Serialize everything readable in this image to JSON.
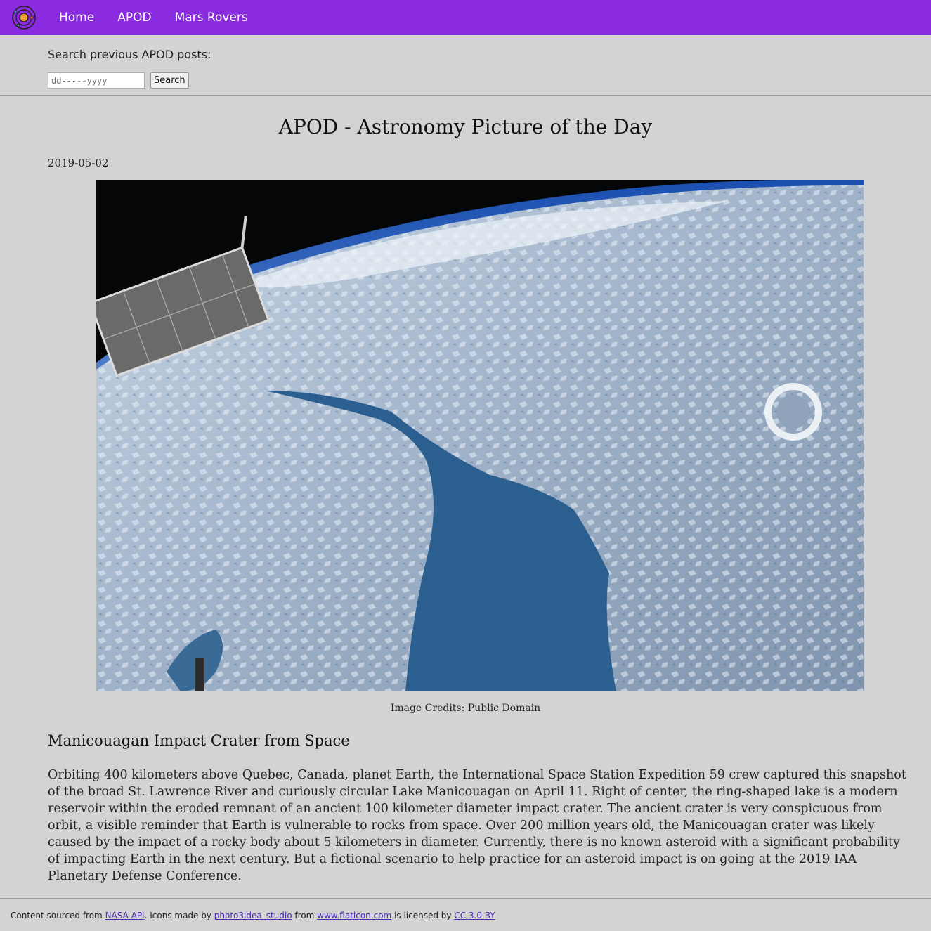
{
  "nav": {
    "logo_icon": "orbit-logo-icon",
    "links": [
      "Home",
      "APOD",
      "Mars Rovers"
    ]
  },
  "search": {
    "label": "Search previous APOD posts:",
    "input_placeholder": "dd-----yyyy",
    "button_label": "Search"
  },
  "apod": {
    "page_title": "APOD - Astronomy Picture of the Day",
    "date": "2019-05-02",
    "image_description_icon": "earth-from-space-photo",
    "credits": "Image Credits: Public Domain",
    "post_title": "Manicouagan Impact Crater from Space",
    "explanation": "Orbiting 400 kilometers above Quebec, Canada, planet Earth, the International Space Station Expedition 59 crew captured this snapshot of the broad St. Lawrence River and curiously circular Lake Manicouagan on April 11. Right of center, the ring-shaped lake is a modern reservoir within the eroded remnant of an ancient 100 kilometer diameter impact crater. The ancient crater is very conspicuous from orbit, a visible reminder that Earth is vulnerable to rocks from space. Over 200 million years old, the Manicouagan crater was likely caused by the impact of a rocky body about 5 kilometers in diameter. Currently, there is no known asteroid with a significant probability of impacting Earth in the next century. But a fictional scenario to help practice for an asteroid impact is on going at the 2019 IAA Planetary Defense Conference."
  },
  "footer": {
    "t1": "Content sourced from ",
    "link1": "NASA API",
    "t2": ". Icons made by ",
    "link2": "photo3idea_studio",
    "t3": " from ",
    "link3": "www.flaticon.com",
    "t4": " is licensed by ",
    "link4": "CC 3.0 BY"
  },
  "colors": {
    "nav_bg": "#8a2be2",
    "page_bg": "#d3d3d3",
    "link": "#4b2ab8"
  }
}
